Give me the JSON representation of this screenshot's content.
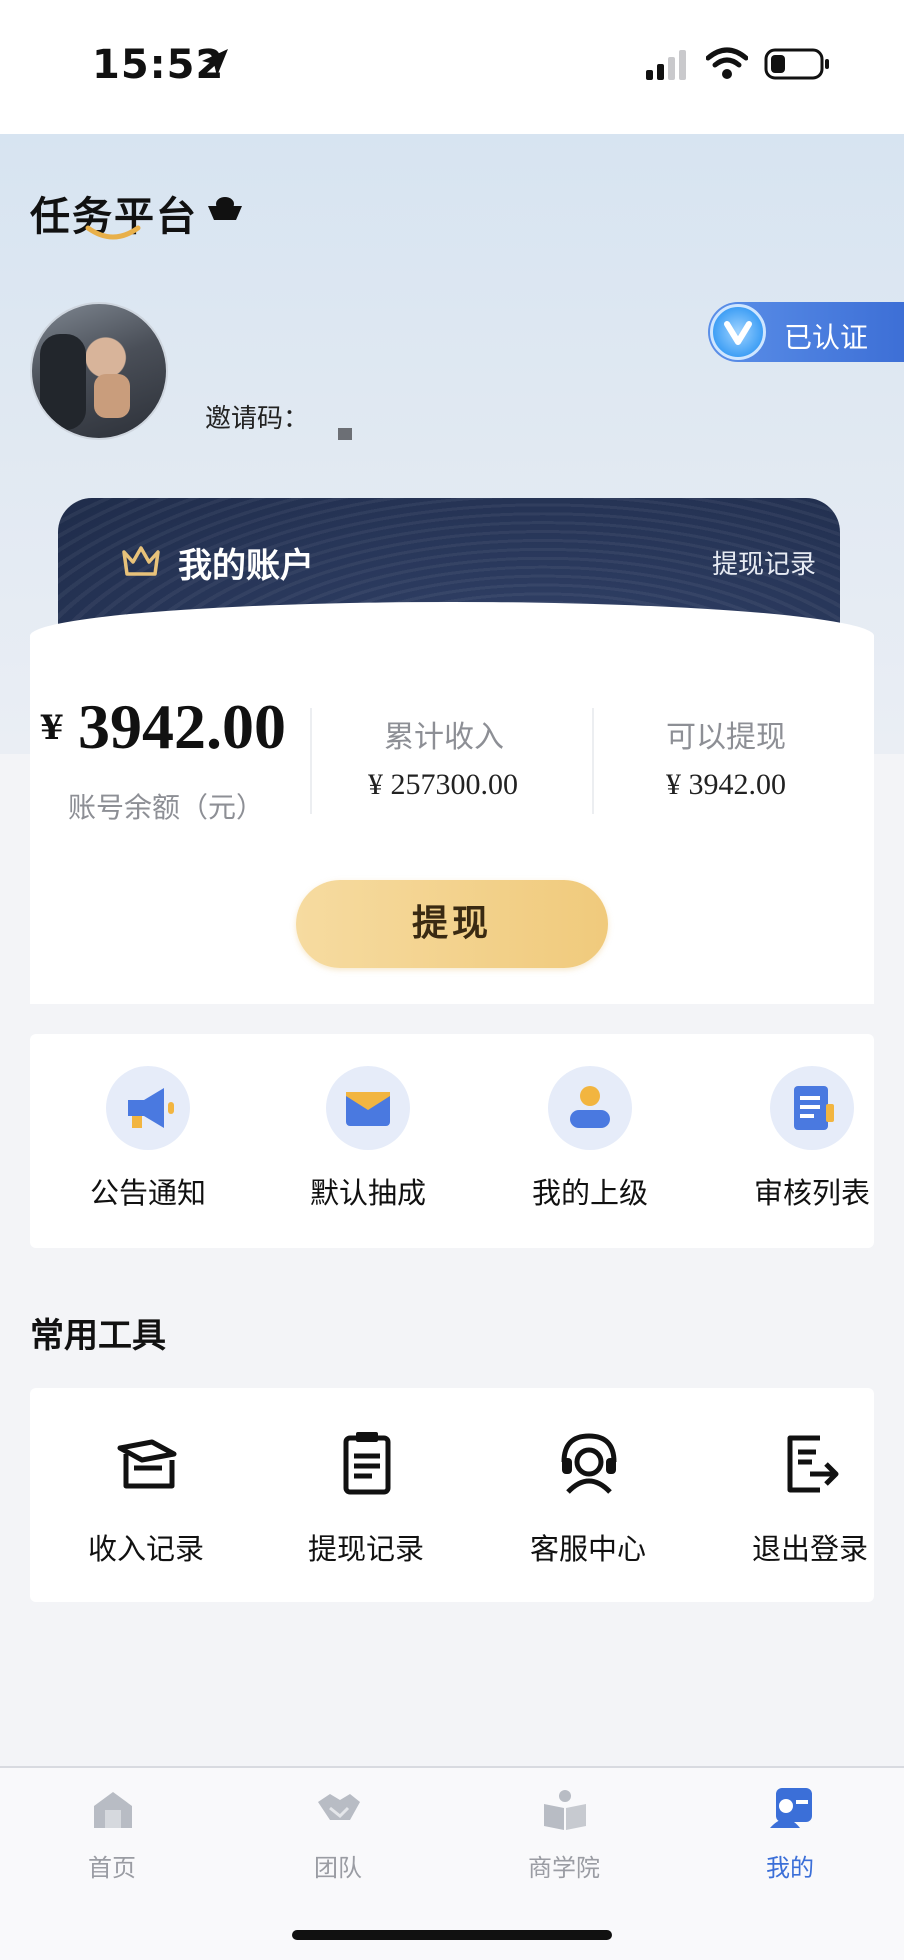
{
  "status_bar": {
    "time": "15:52"
  },
  "header": {
    "app_title": "任务平台"
  },
  "profile": {
    "invite_label": "邀请码：",
    "verified_label": "已认证"
  },
  "account": {
    "title": "我的账户",
    "withdraw_record_link": "提现记录",
    "currency_symbol": "¥",
    "balance": "3942.00",
    "balance_label": "账号余额（元）",
    "total_income_label": "累计收入",
    "total_income_value": "¥ 257300.00",
    "withdrawable_label": "可以提现",
    "withdrawable_value": "¥ 3942.00",
    "withdraw_button": "提现"
  },
  "quick_actions": [
    {
      "label": "公告通知",
      "icon": "megaphone-icon"
    },
    {
      "label": "默认抽成",
      "icon": "envelope-icon"
    },
    {
      "label": "我的上级",
      "icon": "user-icon"
    },
    {
      "label": "审核列表",
      "icon": "document-list-icon"
    }
  ],
  "tools": {
    "title": "常用工具",
    "items": [
      {
        "label": "收入记录",
        "icon": "graduation-cap-icon"
      },
      {
        "label": "提现记录",
        "icon": "clipboard-icon"
      },
      {
        "label": "客服中心",
        "icon": "headset-icon"
      },
      {
        "label": "退出登录",
        "icon": "logout-document-icon"
      }
    ]
  },
  "tab_bar": {
    "items": [
      {
        "label": "首页",
        "icon": "home-icon"
      },
      {
        "label": "团队",
        "icon": "handshake-icon"
      },
      {
        "label": "商学院",
        "icon": "book-icon"
      },
      {
        "label": "我的",
        "icon": "profile-card-icon"
      }
    ],
    "active_index": 3
  },
  "colors": {
    "accent": "#3b6fd8",
    "card_dark": "#243256",
    "gold": "#f0ca7c"
  }
}
